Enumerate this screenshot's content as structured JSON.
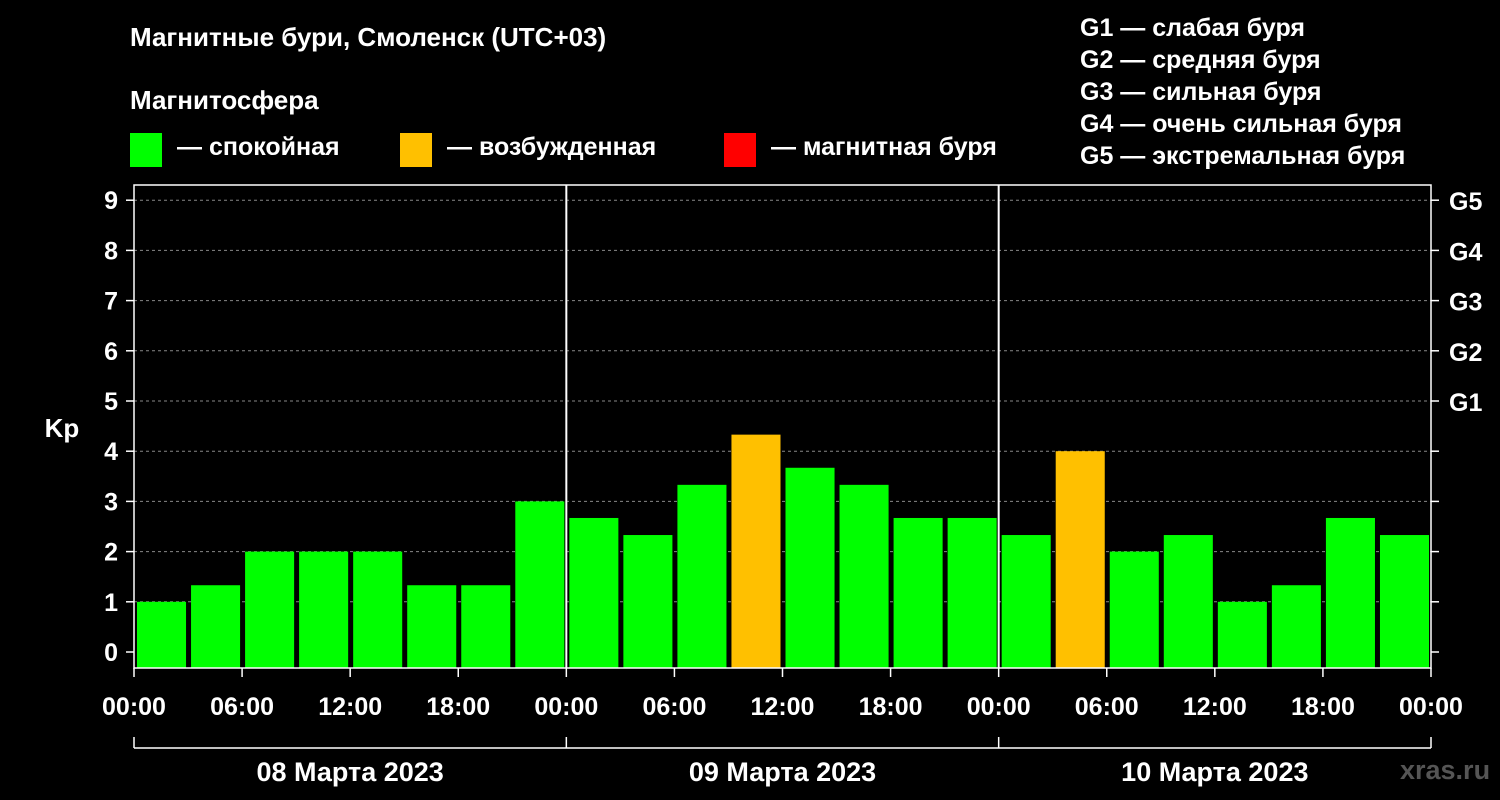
{
  "title": "Магнитные бури, Смоленск (UTC+03)",
  "subtitle": "Магнитосфера",
  "legend": [
    {
      "label": "— спокойная",
      "color": "#00ff00"
    },
    {
      "label": "— возбужденная",
      "color": "#ffc000"
    },
    {
      "label": "— магнитная буря",
      "color": "#ff0000"
    }
  ],
  "g_legend": [
    "G1 — слабая буря",
    "G2 — средняя буря",
    "G3 — сильная буря",
    "G4 — очень сильная буря",
    "G5 — экстремальная буря"
  ],
  "watermark": "xras.ru",
  "colors": {
    "background": "#000000",
    "quiet": "#00ff00",
    "active": "#ffc000",
    "storm": "#ff0000",
    "grid": "#888888"
  },
  "chart_data": {
    "type": "bar",
    "ylabel": "Kp",
    "ylim": [
      0,
      9
    ],
    "y_ticks": [
      "0",
      "1",
      "2",
      "3",
      "4",
      "5",
      "6",
      "7",
      "8",
      "9"
    ],
    "right_ticks": [
      {
        "kp": 5,
        "label": "G1"
      },
      {
        "kp": 6,
        "label": "G2"
      },
      {
        "kp": 7,
        "label": "G3"
      },
      {
        "kp": 8,
        "label": "G4"
      },
      {
        "kp": 9,
        "label": "G5"
      }
    ],
    "x_tick_labels": [
      "00:00",
      "06:00",
      "12:00",
      "18:00",
      "00:00",
      "06:00",
      "12:00",
      "18:00",
      "00:00",
      "06:00",
      "12:00",
      "18:00",
      "00:00"
    ],
    "days": [
      "08 Марта 2023",
      "09 Марта 2023",
      "10 Марта 2023"
    ],
    "grid": "dashed horizontal",
    "bars": [
      {
        "day": "08 Марта 2023",
        "start": "00:00",
        "kp": 1.0,
        "level": "quiet"
      },
      {
        "day": "08 Марта 2023",
        "start": "03:00",
        "kp": 1.33,
        "level": "quiet"
      },
      {
        "day": "08 Марта 2023",
        "start": "06:00",
        "kp": 2.0,
        "level": "quiet"
      },
      {
        "day": "08 Марта 2023",
        "start": "09:00",
        "kp": 2.0,
        "level": "quiet"
      },
      {
        "day": "08 Марта 2023",
        "start": "12:00",
        "kp": 2.0,
        "level": "quiet"
      },
      {
        "day": "08 Марта 2023",
        "start": "15:00",
        "kp": 1.33,
        "level": "quiet"
      },
      {
        "day": "08 Марта 2023",
        "start": "18:00",
        "kp": 1.33,
        "level": "quiet"
      },
      {
        "day": "08 Марта 2023",
        "start": "21:00",
        "kp": 3.0,
        "level": "quiet"
      },
      {
        "day": "09 Марта 2023",
        "start": "00:00",
        "kp": 2.67,
        "level": "quiet"
      },
      {
        "day": "09 Марта 2023",
        "start": "03:00",
        "kp": 2.33,
        "level": "quiet"
      },
      {
        "day": "09 Марта 2023",
        "start": "06:00",
        "kp": 3.33,
        "level": "quiet"
      },
      {
        "day": "09 Марта 2023",
        "start": "09:00",
        "kp": 4.33,
        "level": "active"
      },
      {
        "day": "09 Марта 2023",
        "start": "12:00",
        "kp": 3.67,
        "level": "quiet"
      },
      {
        "day": "09 Марта 2023",
        "start": "15:00",
        "kp": 3.33,
        "level": "quiet"
      },
      {
        "day": "09 Марта 2023",
        "start": "18:00",
        "kp": 2.67,
        "level": "quiet"
      },
      {
        "day": "09 Марта 2023",
        "start": "21:00",
        "kp": 2.67,
        "level": "quiet"
      },
      {
        "day": "10 Марта 2023",
        "start": "00:00",
        "kp": 2.33,
        "level": "quiet"
      },
      {
        "day": "10 Марта 2023",
        "start": "03:00",
        "kp": 4.0,
        "level": "active"
      },
      {
        "day": "10 Марта 2023",
        "start": "06:00",
        "kp": 2.0,
        "level": "quiet"
      },
      {
        "day": "10 Марта 2023",
        "start": "09:00",
        "kp": 2.33,
        "level": "quiet"
      },
      {
        "day": "10 Марта 2023",
        "start": "12:00",
        "kp": 1.0,
        "level": "quiet"
      },
      {
        "day": "10 Марта 2023",
        "start": "15:00",
        "kp": 1.33,
        "level": "quiet"
      },
      {
        "day": "10 Марта 2023",
        "start": "18:00",
        "kp": 2.67,
        "level": "quiet"
      },
      {
        "day": "10 Марта 2023",
        "start": "21:00",
        "kp": 2.33,
        "level": "quiet"
      }
    ]
  }
}
